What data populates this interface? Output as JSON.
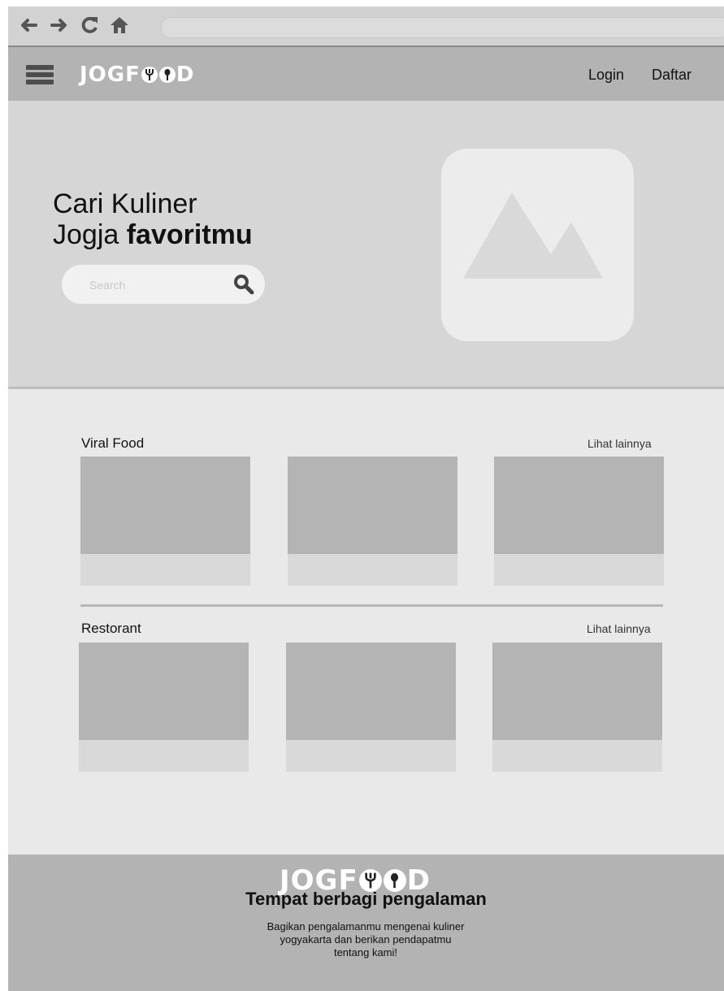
{
  "browser": {
    "icons": [
      "arrow-left-icon",
      "arrow-right-icon",
      "reload-icon",
      "home-icon"
    ],
    "url": ""
  },
  "header": {
    "logo": {
      "pre": "JOGF",
      "post": "D"
    },
    "login_label": "Login",
    "register_label": "Daftar"
  },
  "hero": {
    "title_line1": "Cari Kuliner",
    "title_line2_regular": "Jogja ",
    "title_line2_bold": "favoritmu",
    "search_placeholder": "Search"
  },
  "sections": [
    {
      "title": "Viral Food",
      "see_more": "Lihat lainnya",
      "card_count": 3
    },
    {
      "title": "Restorant",
      "see_more": "Lihat lainnya",
      "card_count": 3
    }
  ],
  "footer": {
    "logo": {
      "pre": "JOGF",
      "post": "D"
    },
    "tagline": "Tempat berbagi pengalaman",
    "desc_line1": "Bagikan pengalamanmu mengenai kuliner",
    "desc_line2": "yogyakarta dan berikan pendapatmu",
    "desc_line3": "tentang kami!"
  },
  "colors": {
    "header": "#b3b3b3",
    "hero": "#d6d6d6",
    "content": "#e9e9e9",
    "placeholder_img": "#b4b4b4",
    "caption": "#d9d9d9"
  }
}
